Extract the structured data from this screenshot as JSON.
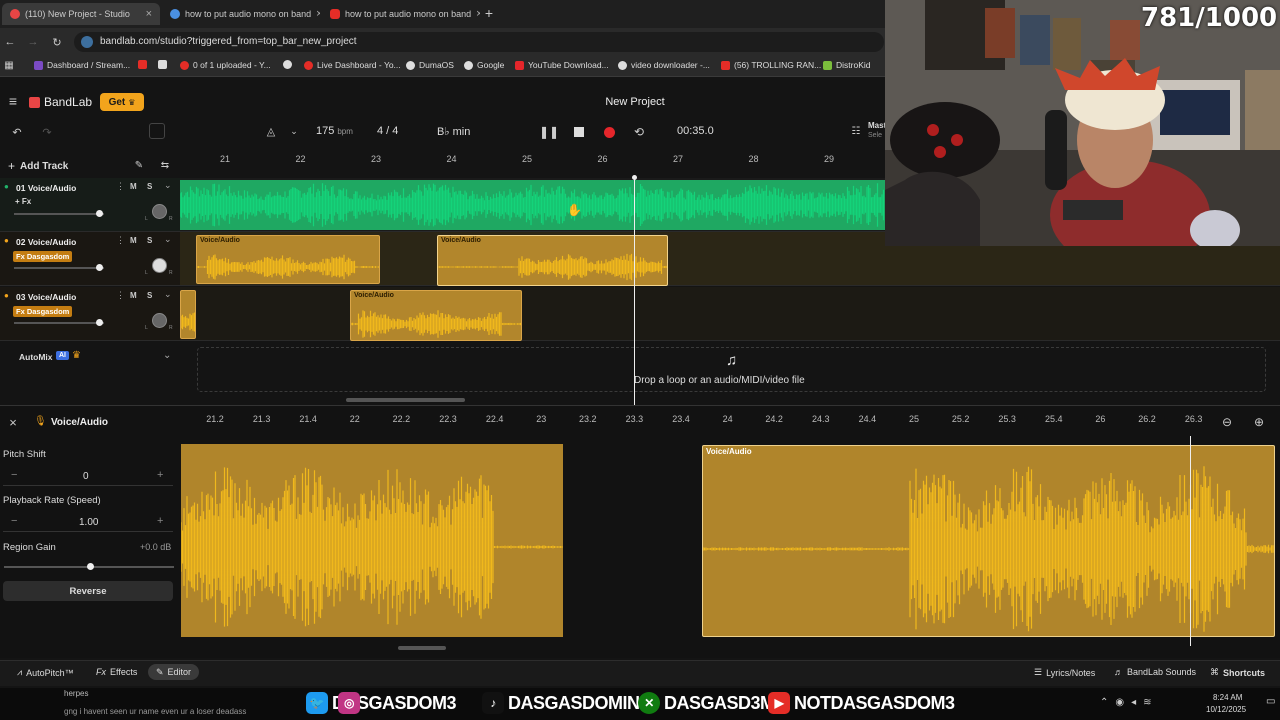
{
  "browser": {
    "tabs": [
      {
        "title": "(110) New Project - Studio",
        "active": true,
        "fav": "#e84545"
      },
      {
        "title": "how to put audio mono on band",
        "active": false,
        "fav": "#4a90e2"
      },
      {
        "title": "how to put audio mono on band",
        "active": false,
        "fav": "#e52d27"
      }
    ],
    "new_tab": "+",
    "url": "bandlab.com/studio?triggered_from=top_bar_new_project",
    "bookmarks": [
      "Dashboard / Stream...",
      "0 of 1 uploaded - Y...",
      "Live Dashboard - Yo...",
      "DumaOS",
      "Google",
      "YouTube Download...",
      "video downloader -...",
      "(56) TROLLING RAN...",
      "DistroKid"
    ]
  },
  "app": {
    "brand": "BandLab",
    "get_label": "Get",
    "project_title": "New Project",
    "master_label": "Mast",
    "master_sub": "Sele"
  },
  "transport": {
    "bpm_value": "175",
    "bpm_unit": "bpm",
    "time_sig": "4 / 4",
    "key": "B♭ min",
    "time": "00:35.0"
  },
  "tracks_panel": {
    "add_track": "Add Track",
    "ruler_marks": [
      "21",
      "22",
      "23",
      "24",
      "25",
      "26",
      "27",
      "28",
      "29"
    ],
    "tracks": [
      {
        "name": "01  Voice/Audio",
        "fx": "+ Fx",
        "fx_badge": false
      },
      {
        "name": "02  Voice/Audio",
        "fx": "Fx Dasgasdom",
        "fx_badge": true
      },
      {
        "name": "03  Voice/Audio",
        "fx": "Fx Dasgasdom",
        "fx_badge": true
      }
    ],
    "mute": "M",
    "solo": "S",
    "pan_l": "L",
    "pan_r": "R",
    "clip_label": "Voice/Audio",
    "automix": "AutoMix",
    "ai_badge": "AI",
    "drop_text": "Drop a loop or an audio/MIDI/video file"
  },
  "editor": {
    "track_name": "Voice/Audio",
    "ruler_marks": [
      "21.2",
      "21.3",
      "21.4",
      "22",
      "22.2",
      "22.3",
      "22.4",
      "23",
      "23.2",
      "23.3",
      "23.4",
      "24",
      "24.2",
      "24.3",
      "24.4",
      "25",
      "25.2",
      "25.3",
      "25.4",
      "26",
      "26.2",
      "26.3"
    ],
    "pitch_shift_label": "Pitch Shift",
    "pitch_shift_value": "0",
    "playback_rate_label": "Playback Rate (Speed)",
    "playback_rate_value": "1.00",
    "region_gain_label": "Region Gain",
    "region_gain_value": "+0.0 dB",
    "region_gain_level": 0.5,
    "reverse_label": "Reverse",
    "minus": "−",
    "plus": "+",
    "clip_label": "Voice/Audio"
  },
  "bottom_bar": {
    "autopitch": "AutoPitch™",
    "effects": "Effects",
    "editor": "Editor",
    "lyrics": "Lyrics/Notes",
    "sounds": "BandLab Sounds",
    "shortcuts": "Shortcuts"
  },
  "overlay": {
    "counter": "781/1000",
    "chat_line1": "herpes",
    "chat_line2": "gng i havent seen ur name even ur a loser deadass",
    "socials": [
      "DASGASDOM3",
      "DASGASDOMINI",
      "DASGASD3M",
      "NOTDASGASDOM3"
    ],
    "clock_time": "8:24 AM",
    "clock_date": "10/12/2025"
  },
  "colors": {
    "green_track": "#21b36a",
    "clip_gold": "#b2862c",
    "wave_gold": "#f0b81c",
    "fx_orange": "#c47d12",
    "record_red": "#e5262b"
  }
}
